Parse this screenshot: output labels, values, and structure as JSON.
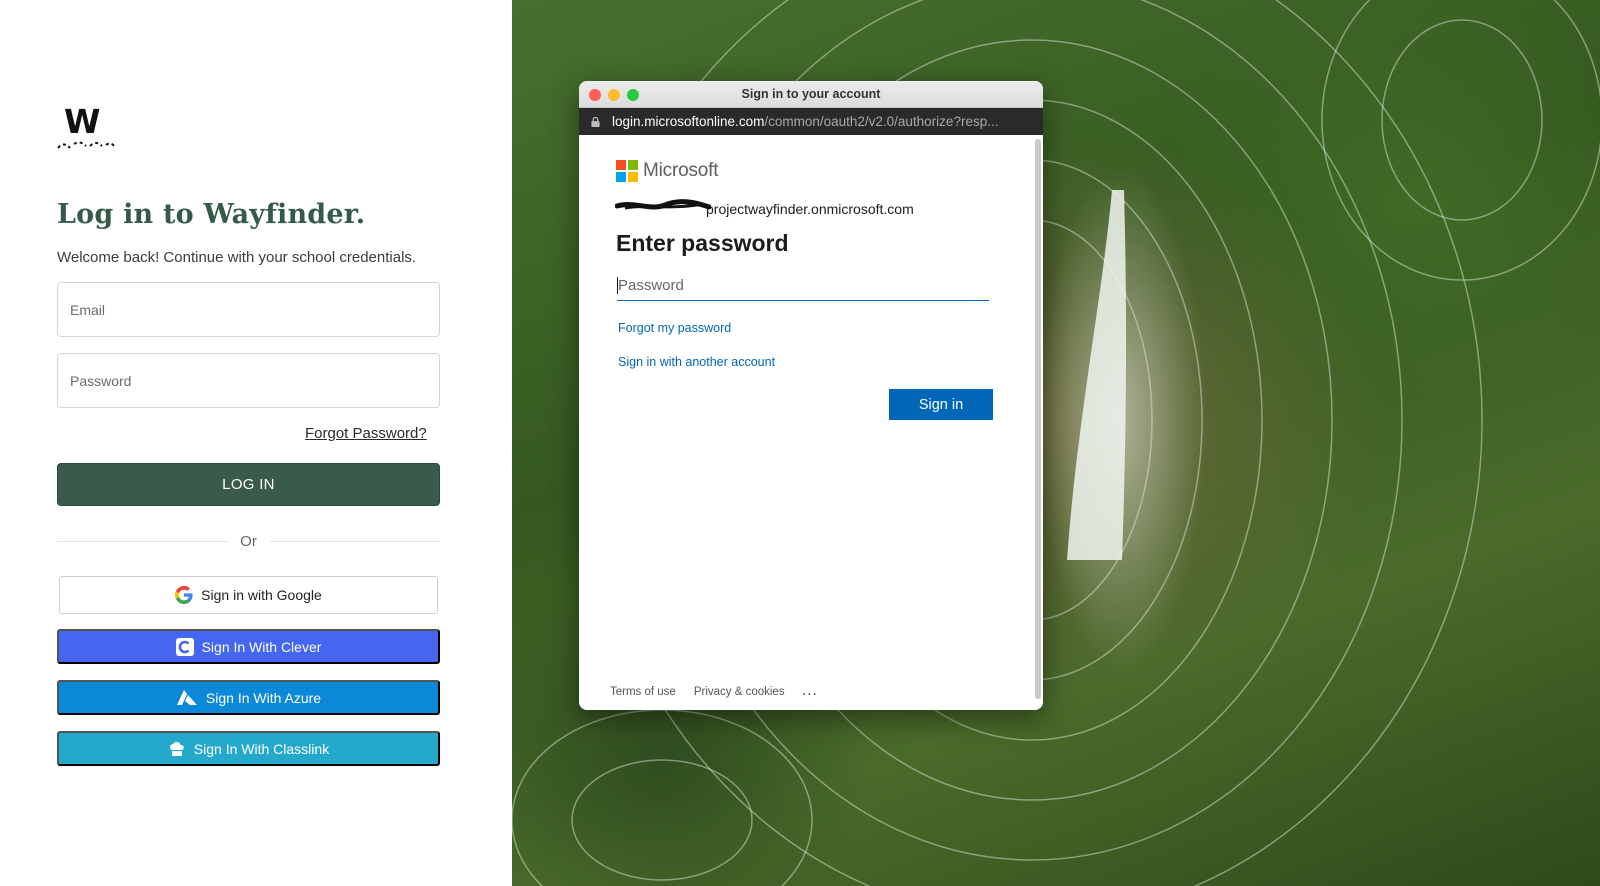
{
  "left_panel": {
    "logo_letter": "W",
    "title": "Log in to Wayfinder.",
    "subtitle": "Welcome back! Continue with your school credentials.",
    "email_placeholder": "Email",
    "password_placeholder": "Password",
    "forgot_password": "Forgot Password?",
    "login_button": "LOG IN",
    "divider_text": "Or",
    "sso": {
      "google": "Sign in with Google",
      "clever": "Sign In With Clever",
      "azure": "Sign In With Azure",
      "classlink": "Sign In With Classlink"
    },
    "colors": {
      "title": "#365a49",
      "login_button": "#3a5a4b",
      "clever": "#4466f0",
      "azure": "#0c88d8",
      "classlink": "#24a9cd"
    }
  },
  "popup": {
    "window_title": "Sign in to your account",
    "url_host": "login.microsoftonline.com",
    "url_path": "/common/oauth2/v2.0/authorize?resp...",
    "brand": "Microsoft",
    "account": "projectwayfinder.onmicrosoft.com",
    "heading": "Enter password",
    "password_placeholder": "Password",
    "forgot_link": "Forgot my password",
    "another_account_link": "Sign in with another account",
    "sign_in_button": "Sign in",
    "footer": {
      "terms": "Terms of use",
      "privacy": "Privacy & cookies",
      "more": "..."
    },
    "colors": {
      "primary": "#0067b8",
      "ms_red": "#f25022",
      "ms_green": "#7fba00",
      "ms_blue": "#00a4ef",
      "ms_yellow": "#ffb900"
    }
  },
  "background": {
    "description_icon": "waterfall-jungle-photo"
  }
}
